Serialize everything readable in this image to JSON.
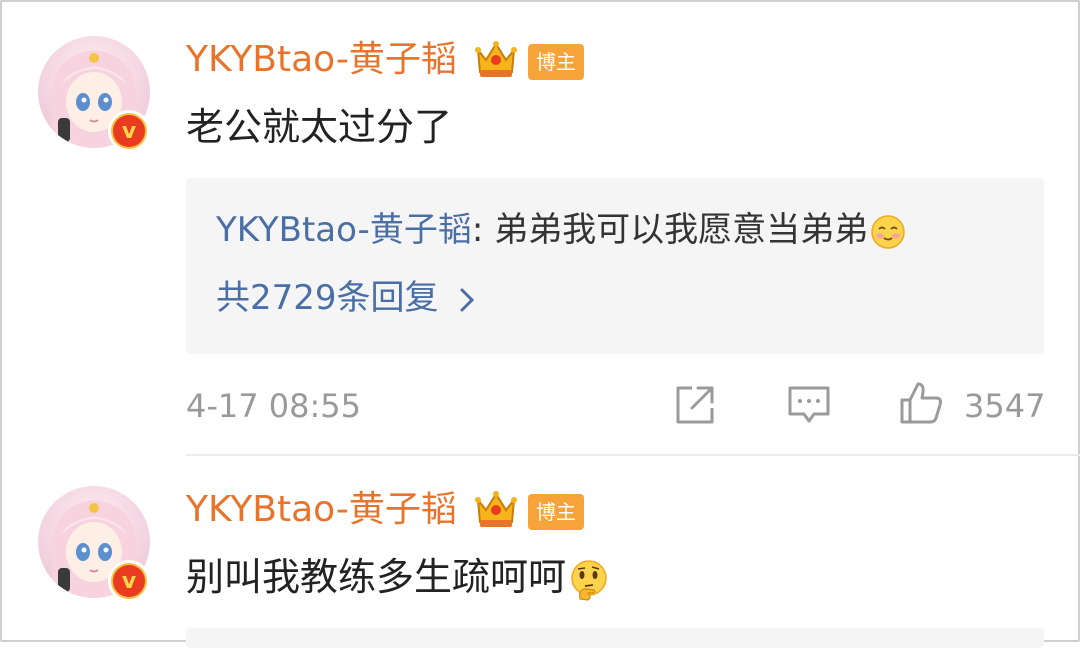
{
  "comments": [
    {
      "username": "YKYBtao-黄子韬",
      "badge": "博主",
      "text": "老公就太过分了",
      "reply": {
        "name": "YKYBtao-黄子韬",
        "separator": ":",
        "text": " 弟弟我可以我愿意当弟弟",
        "emoji": "shy-smile-emoji"
      },
      "more_replies": "共2729条回复",
      "timestamp": "4-17 08:55",
      "like_count": "3547"
    },
    {
      "username": "YKYBtao-黄子韬",
      "badge": "博主",
      "text": "别叫我教练多生疏呵呵",
      "emoji": "thinking-face-emoji"
    }
  ],
  "colors": {
    "username": "#e8742b",
    "link": "#4a6fa5",
    "badge_bg": "#f6a33a",
    "verified": "#e83b1f",
    "muted": "#9a9a9a"
  },
  "icons": [
    "crown-icon",
    "verified-v-icon",
    "share-icon",
    "comment-icon",
    "like-icon",
    "chevron-right-icon"
  ]
}
